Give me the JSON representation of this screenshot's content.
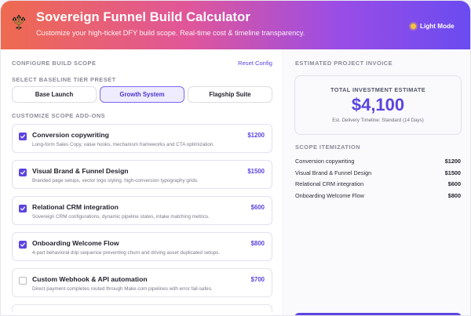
{
  "header": {
    "title": "Sovereign Funnel Build Calculator",
    "subtitle": "Customize your high-ticket DFY build scope. Real-time cost & timeline transparency.",
    "mode_label": "Light Mode",
    "logo_icon": "trident-icon"
  },
  "config": {
    "section_title": "CONFIGURE BUILD SCOPE",
    "reset_label": "Reset Config",
    "tier_label": "SELECT BASELINE TIER PRESET",
    "tiers": [
      {
        "label": "Base Launch",
        "active": false
      },
      {
        "label": "Growth System",
        "active": true
      },
      {
        "label": "Flagship Suite",
        "active": false
      }
    ],
    "addons_label": "CUSTOMIZE SCOPE ADD-ONS",
    "addons": [
      {
        "name": "Conversion copywriting",
        "desc": "Long-form Sales Copy, value hooks, mechanism frameworks and CTA optimization.",
        "price": "$1200",
        "checked": true
      },
      {
        "name": "Visual Brand & Funnel Design",
        "desc": "Branded page setups, vector logo styling, high-conversion typography grids.",
        "price": "$1500",
        "checked": true
      },
      {
        "name": "Relational CRM integration",
        "desc": "Sovereign CRM configurations, dynamic pipeline states, intake matching metrics.",
        "price": "$600",
        "checked": true
      },
      {
        "name": "Onboarding Welcome Flow",
        "desc": "4-part behavioral drip sequence preventing churn and driving asset duplicated setups.",
        "price": "$800",
        "checked": true
      },
      {
        "name": "Custom Webhook & API automation",
        "desc": "Direct payment completes routed through Make.com pipelines with error fail-safes.",
        "price": "$700",
        "checked": false
      }
    ]
  },
  "invoice": {
    "section_title": "ESTIMATED PROJECT INVOICE",
    "total_label": "TOTAL INVESTMENT ESTIMATE",
    "total_amount": "$4,100",
    "eta": "Est. Delivery Timeline: Standard (14 Days)",
    "itemization_title": "SCOPE ITEMIZATION",
    "items": [
      {
        "name": "Conversion copywriting",
        "price": "$1200"
      },
      {
        "name": "Visual Brand & Funnel Design",
        "price": "$1500"
      },
      {
        "name": "Relational CRM integration",
        "price": "$600"
      },
      {
        "name": "Onboarding Welcome Flow",
        "price": "$800"
      }
    ]
  },
  "colors": {
    "accent": "#5b45e0",
    "header_gradient": [
      "#ef6a4f",
      "#e0569a",
      "#9a4de6",
      "#6a4bf0"
    ]
  }
}
